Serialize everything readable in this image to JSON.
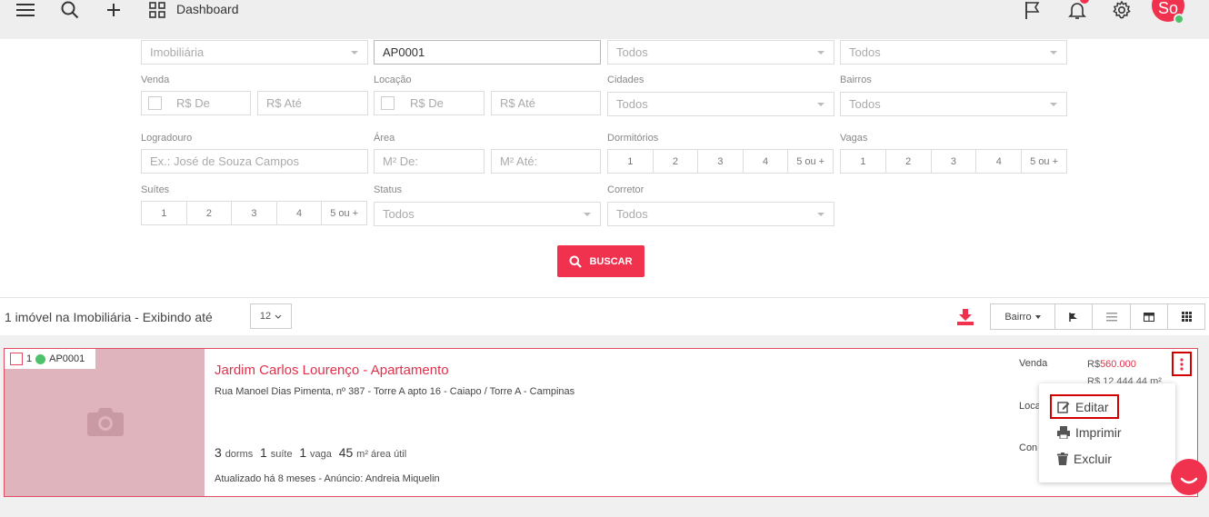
{
  "topbar": {
    "title": "Dashboard",
    "avatar_initials": "So",
    "icons": [
      "menu-icon",
      "search-icon",
      "plus-icon",
      "dashboard-grid-icon",
      "flag-icon",
      "bell-icon",
      "gear-icon"
    ]
  },
  "filters": {
    "row1": {
      "agency": "Imobiliária",
      "code": "AP0001",
      "select_3": "Todos",
      "select_4": "Todos"
    },
    "venda": {
      "label": "Venda",
      "from": "R$ De",
      "to": "R$ Até"
    },
    "locacao": {
      "label": "Locação",
      "from": "R$ De",
      "to": "R$ Até"
    },
    "cidades": {
      "label": "Cidades",
      "value": "Todos"
    },
    "bairros": {
      "label": "Bairros",
      "value": "Todos"
    },
    "logradouro": {
      "label": "Logradouro",
      "placeholder": "Ex.: José de Souza Campos"
    },
    "area": {
      "label": "Área",
      "from": "M² De:",
      "to": "M² Até:"
    },
    "dormitorios": {
      "label": "Dormitórios",
      "options": [
        "1",
        "2",
        "3",
        "4",
        "5 ou +"
      ]
    },
    "vagas": {
      "label": "Vagas",
      "options": [
        "1",
        "2",
        "3",
        "4",
        "5 ou +"
      ]
    },
    "suites": {
      "label": "Suítes",
      "options": [
        "1",
        "2",
        "3",
        "4",
        "5 ou +"
      ]
    },
    "status": {
      "label": "Status",
      "value": "Todos"
    },
    "corretor": {
      "label": "Corretor",
      "value": "Todos"
    },
    "search_button": "BUSCAR"
  },
  "results": {
    "summary": "1 imóvel na Imobiliária - Exibindo até",
    "per_page": "12",
    "sort_button": "Bairro"
  },
  "listing": {
    "index": "1",
    "code": "AP0001",
    "title": "Jardim Carlos Lourenço - Apartamento",
    "address": "Rua Manoel Dias Pimenta, nº 387 - Torre A apto 16 - Caiapo / Torre A - Campinas",
    "dorms": "3",
    "dorms_label": "dorms",
    "suites": "1",
    "suites_label": "suíte",
    "vagas": "1",
    "vagas_label": "vaga",
    "area": "45",
    "area_label": "m² área útil",
    "updated": "Atualizado há 8 meses - Anúncio: Andreia Miquelin",
    "venda_label": "Venda",
    "currency": "R$",
    "venda_value": "560.000",
    "venda_per_m2": "R$ 12.444,44 m²",
    "locacao_label_partial": "Loca",
    "condominio_label_partial": "Con"
  },
  "menu": {
    "edit": "Editar",
    "print": "Imprimir",
    "delete": "Excluir"
  },
  "colors": {
    "accent": "#f0324f",
    "highlight": "#d40000",
    "online": "#4cc26a"
  }
}
